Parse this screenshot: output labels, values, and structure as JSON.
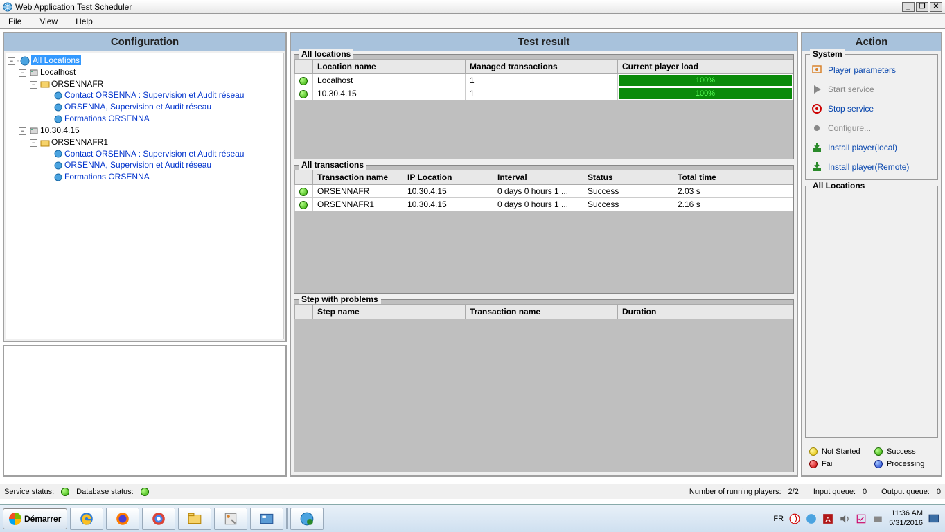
{
  "window": {
    "title": "Web Application Test Scheduler"
  },
  "menu": {
    "file": "File",
    "view": "View",
    "help": "Help"
  },
  "panels": {
    "configuration": "Configuration",
    "testResult": "Test result",
    "action": "Action"
  },
  "tree": {
    "root": "All Locations",
    "loc1": {
      "name": "Localhost",
      "group": "ORSENNAFR",
      "items": [
        "Contact ORSENNA : Supervision et Audit réseau",
        "ORSENNA, Supervision et Audit réseau",
        "Formations ORSENNA"
      ]
    },
    "loc2": {
      "name": "10.30.4.15",
      "group": "ORSENNAFR1",
      "items": [
        "Contact ORSENNA : Supervision et Audit réseau",
        "ORSENNA, Supervision et Audit réseau",
        "Formations ORSENNA"
      ]
    }
  },
  "allLocations": {
    "legend": "All locations",
    "headers": {
      "status": "",
      "name": "Location name",
      "managed": "Managed transactions",
      "load": "Current player load"
    },
    "rows": [
      {
        "name": "Localhost",
        "managed": "1",
        "load": "100%"
      },
      {
        "name": "10.30.4.15",
        "managed": "1",
        "load": "100%"
      }
    ]
  },
  "allTransactions": {
    "legend": "All transactions",
    "headers": {
      "status": "",
      "name": "Transaction name",
      "ip": "IP Location",
      "interval": "Interval",
      "stat": "Status",
      "time": "Total time"
    },
    "rows": [
      {
        "name": "ORSENNAFR",
        "ip": "10.30.4.15",
        "interval": "0 days 0 hours 1 ...",
        "stat": "Success",
        "time": "2.03 s"
      },
      {
        "name": "ORSENNAFR1",
        "ip": "10.30.4.15",
        "interval": "0 days 0 hours 1 ...",
        "stat": "Success",
        "time": "2.16 s"
      }
    ]
  },
  "stepProblems": {
    "legend": "Step with problems",
    "headers": {
      "status": "",
      "step": "Step name",
      "tx": "Transaction name",
      "dur": "Duration"
    }
  },
  "action": {
    "systemLegend": "System",
    "items": {
      "playerParams": "Player parameters",
      "startService": "Start service",
      "stopService": "Stop service",
      "configure": "Configure...",
      "installLocal": "Install player(local)",
      "installRemote": "Install player(Remote)"
    },
    "allLocationsLegend": "All Locations",
    "legend": {
      "notStarted": "Not Started",
      "success": "Success",
      "fail": "Fail",
      "processing": "Processing"
    }
  },
  "statusbar": {
    "serviceStatus": "Service status:",
    "databaseStatus": "Database status:",
    "runningPlayersLabel": "Number of running players:",
    "runningPlayersValue": "2/2",
    "inputQueueLabel": "Input queue:",
    "inputQueueValue": "0",
    "outputQueueLabel": "Output queue:",
    "outputQueueValue": "0"
  },
  "taskbar": {
    "start": "Démarrer",
    "lang": "FR",
    "time": "11:36 AM",
    "date": "5/31/2016"
  }
}
